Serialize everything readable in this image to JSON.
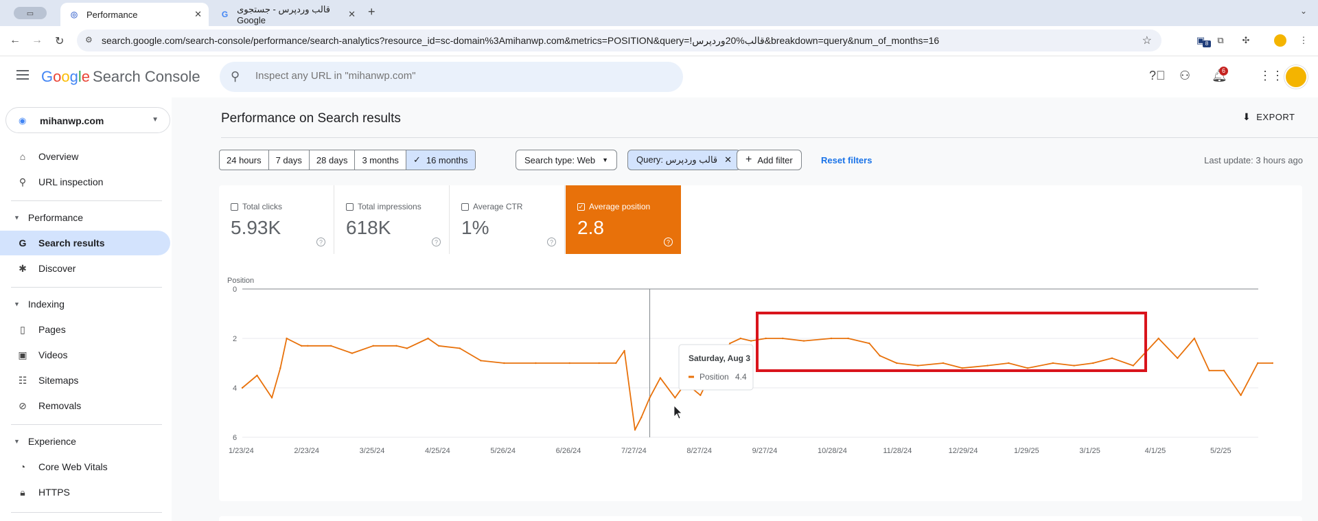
{
  "browser": {
    "tabs": [
      {
        "title": "Performance",
        "active": true
      },
      {
        "title": "قالب وردپرس - جستجوی Google",
        "active": false
      }
    ],
    "new_tab": "+",
    "url": "search.google.com/search-console/performance/search-analytics?resource_id=sc-domain%3Amihanwp.com&metrics=POSITION&query=!قالب%20وردپرس&breakdown=query&num_of_months=16",
    "ext_badge": "8"
  },
  "header": {
    "logo_g": [
      "G",
      "o",
      "o",
      "g",
      "l",
      "e"
    ],
    "product": "Search Console",
    "search_placeholder": "Inspect any URL in \"mihanwp.com\"",
    "notifications_count": "6"
  },
  "sidebar": {
    "property": "mihanwp.com",
    "items": [
      {
        "label": "Overview",
        "icon": "home-icon"
      },
      {
        "label": "URL inspection",
        "icon": "search-icon"
      }
    ],
    "performance": {
      "title": "Performance",
      "items": [
        {
          "label": "Search results",
          "icon": "google-g-icon",
          "active": true
        },
        {
          "label": "Discover",
          "icon": "asterisk-icon"
        }
      ]
    },
    "indexing": {
      "title": "Indexing",
      "items": [
        {
          "label": "Pages",
          "icon": "page-icon"
        },
        {
          "label": "Videos",
          "icon": "video-icon"
        },
        {
          "label": "Sitemaps",
          "icon": "sitemap-icon"
        },
        {
          "label": "Removals",
          "icon": "eye-off-icon"
        }
      ]
    },
    "experience": {
      "title": "Experience",
      "items": [
        {
          "label": "Core Web Vitals",
          "icon": "gauge-icon"
        },
        {
          "label": "HTTPS",
          "icon": "lock-icon"
        }
      ]
    }
  },
  "main": {
    "title": "Performance on Search results",
    "export_label": "EXPORT",
    "date_ranges": [
      "24 hours",
      "7 days",
      "28 days",
      "3 months",
      "16 months"
    ],
    "selected_range": "16 months",
    "search_type": "Search type: Web",
    "query_chip": "Query: قالب وردپرس",
    "add_filter": "Add filter",
    "reset_filters": "Reset filters",
    "last_update": "Last update: 3 hours ago",
    "metrics": [
      {
        "label": "Total clicks",
        "value": "5.93K",
        "checked": false
      },
      {
        "label": "Total impressions",
        "value": "618K",
        "checked": false
      },
      {
        "label": "Average CTR",
        "value": "1%",
        "checked": false
      },
      {
        "label": "Average position",
        "value": "2.8",
        "checked": true
      }
    ],
    "tooltip": {
      "date": "Saturday, Aug 3",
      "series": "Position",
      "value": "4.4"
    },
    "accent_color": "#e8710a",
    "highlight_color": "#d9141c"
  },
  "chart_data": {
    "type": "line",
    "ylabel": "Position",
    "ylim": [
      0,
      6
    ],
    "y_inverted": true,
    "yticks": [
      "0",
      "2",
      "4",
      "6"
    ],
    "xticks": [
      "1/23/24",
      "2/23/24",
      "3/25/24",
      "4/25/24",
      "5/26/24",
      "6/26/24",
      "7/27/24",
      "8/27/24",
      "9/27/24",
      "10/28/24",
      "11/28/24",
      "12/29/24",
      "1/29/25",
      "3/1/25",
      "4/1/25",
      "5/2/25"
    ],
    "series": [
      {
        "name": "Position",
        "color": "#e8710a",
        "x": [
          "2024-01-23",
          "2024-01-30",
          "2024-02-06",
          "2024-02-10",
          "2024-02-13",
          "2024-02-20",
          "2024-02-23",
          "2024-03-05",
          "2024-03-15",
          "2024-03-25",
          "2024-04-05",
          "2024-04-10",
          "2024-04-20",
          "2024-04-25",
          "2024-05-05",
          "2024-05-15",
          "2024-05-26",
          "2024-06-10",
          "2024-06-26",
          "2024-07-10",
          "2024-07-18",
          "2024-07-22",
          "2024-07-27",
          "2024-07-30",
          "2024-08-03",
          "2024-08-08",
          "2024-08-15",
          "2024-08-20",
          "2024-08-27",
          "2024-09-03",
          "2024-09-10",
          "2024-09-15",
          "2024-09-20",
          "2024-09-27",
          "2024-10-05",
          "2024-10-15",
          "2024-10-28",
          "2024-11-05",
          "2024-11-15",
          "2024-11-20",
          "2024-11-28",
          "2024-12-08",
          "2024-12-20",
          "2024-12-29",
          "2025-01-10",
          "2025-01-20",
          "2025-01-29",
          "2025-02-10",
          "2025-02-20",
          "2025-03-01",
          "2025-03-10",
          "2025-03-20",
          "2025-04-01",
          "2025-04-10",
          "2025-04-18",
          "2025-04-25",
          "2025-05-02",
          "2025-05-10",
          "2025-05-18",
          "2025-05-25"
        ],
        "y": [
          4.0,
          3.5,
          4.4,
          3.2,
          2.0,
          2.3,
          2.3,
          2.3,
          2.6,
          2.3,
          2.3,
          2.4,
          2.0,
          2.3,
          2.4,
          2.9,
          3.0,
          3.0,
          3.0,
          3.0,
          3.0,
          2.5,
          5.7,
          5.2,
          4.4,
          3.6,
          4.4,
          3.8,
          4.3,
          3.1,
          2.2,
          2.0,
          2.1,
          2.0,
          2.0,
          2.1,
          2.0,
          2.0,
          2.2,
          2.7,
          3.0,
          3.1,
          3.0,
          3.2,
          3.1,
          3.0,
          3.2,
          3.0,
          3.1,
          3.0,
          2.8,
          3.1,
          2.0,
          2.8,
          2.0,
          3.3,
          3.3,
          4.3,
          3.0,
          3.0
        ]
      }
    ],
    "grid": true,
    "legend": "none"
  }
}
